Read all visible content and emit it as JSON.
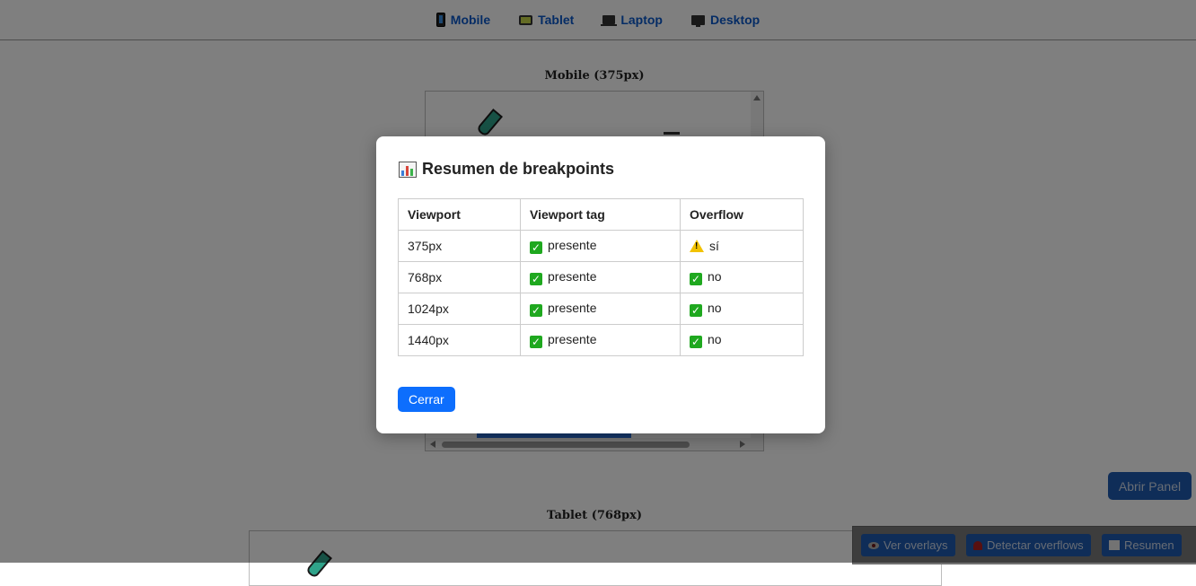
{
  "nav": {
    "items": [
      {
        "label": "Mobile",
        "icon": "mobile-phone-icon"
      },
      {
        "label": "Tablet",
        "icon": "tablet-icon"
      },
      {
        "label": "Laptop",
        "icon": "laptop-icon"
      },
      {
        "label": "Desktop",
        "icon": "desktop-icon"
      }
    ]
  },
  "frames": {
    "mobile_title": "Mobile (375px)",
    "tablet_title": "Tablet (768px)"
  },
  "modal": {
    "title": "Resumen de breakpoints",
    "title_icon": "bar-chart-icon",
    "columns": [
      "Viewport",
      "Viewport tag",
      "Overflow"
    ],
    "rows": [
      {
        "viewport": "375px",
        "tag": "presente",
        "overflow": "sí",
        "overflow_status": "warning"
      },
      {
        "viewport": "768px",
        "tag": "presente",
        "overflow": "no",
        "overflow_status": "ok"
      },
      {
        "viewport": "1024px",
        "tag": "presente",
        "overflow": "no",
        "overflow_status": "ok"
      },
      {
        "viewport": "1440px",
        "tag": "presente",
        "overflow": "no",
        "overflow_status": "ok"
      }
    ],
    "close_label": "Cerrar"
  },
  "panel": {
    "open_label": "Abrir Panel"
  },
  "toolbar": {
    "overlays_label": "Ver overlays",
    "detect_label": "Detectar overflows",
    "summary_label": "Resumen"
  },
  "colors": {
    "accent": "#0d6efd",
    "nav_link": "#0a58ca",
    "ok": "#1fa81f",
    "warning": "#f2c200"
  }
}
